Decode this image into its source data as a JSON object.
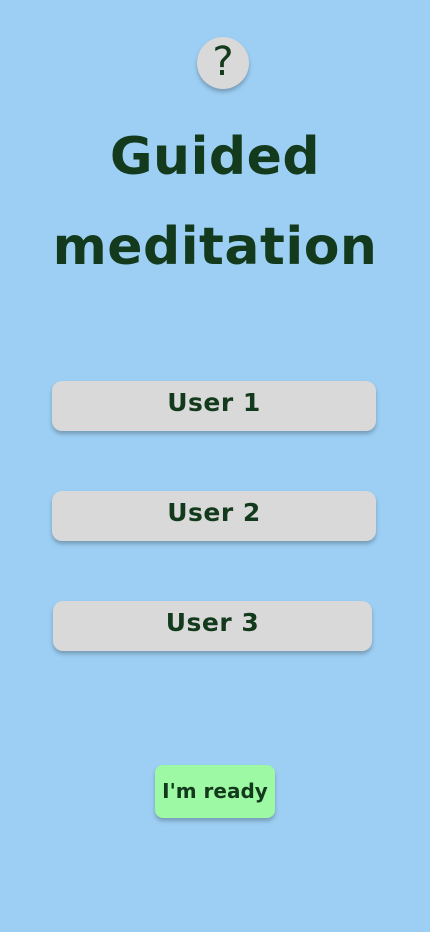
{
  "help": {
    "label": "?"
  },
  "title": {
    "line1": "Guided",
    "line2": "meditation"
  },
  "users": [
    {
      "label": "User 1"
    },
    {
      "label": "User 2"
    },
    {
      "label": "User 3"
    }
  ],
  "ready": {
    "label": "I'm ready"
  },
  "colors": {
    "background": "#9dcff4",
    "button": "#d9d9d9",
    "ready_button": "#9ef9a4",
    "text": "#133a1c"
  }
}
